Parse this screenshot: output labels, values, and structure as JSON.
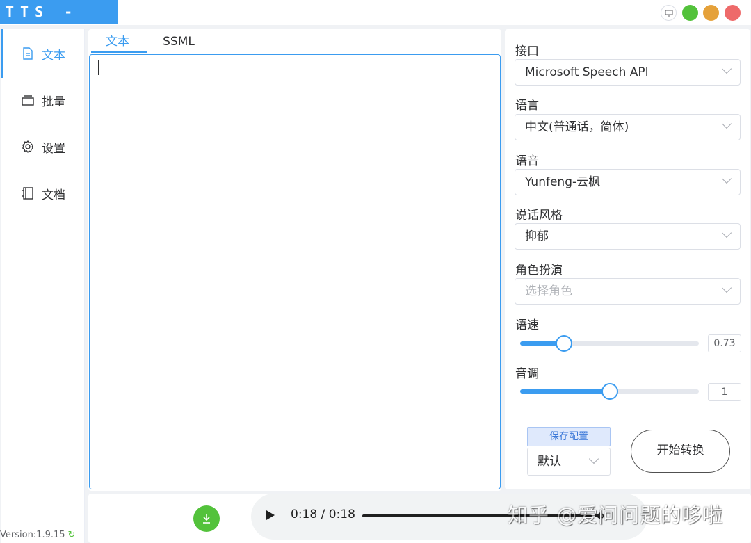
{
  "app": {
    "logo": "TTS - VUE"
  },
  "window_controls": [
    "monitor-icon",
    "green",
    "orange",
    "red"
  ],
  "sidebar": {
    "items": [
      {
        "label": "文本",
        "icon": "document-icon",
        "active": true
      },
      {
        "label": "批量",
        "icon": "stack-icon",
        "active": false
      },
      {
        "label": "设置",
        "icon": "gear-icon",
        "active": false
      },
      {
        "label": "文档",
        "icon": "notebook-icon",
        "active": false
      }
    ],
    "version": "Version:1.9.15",
    "version_icon": "refresh-icon"
  },
  "editor": {
    "tabs": [
      {
        "label": "文本",
        "active": true
      },
      {
        "label": "SSML",
        "active": false
      }
    ],
    "text": ""
  },
  "settings": {
    "api": {
      "label": "接口",
      "value": "Microsoft Speech API"
    },
    "language": {
      "label": "语言",
      "value": "中文(普通话，简体)"
    },
    "voice": {
      "label": "语音",
      "value": "Yunfeng-云枫"
    },
    "style": {
      "label": "说话风格",
      "value": "抑郁"
    },
    "role": {
      "label": "角色扮演",
      "placeholder": "选择角色"
    },
    "rate": {
      "label": "语速",
      "value": "0.73",
      "percent": 24.5
    },
    "pitch": {
      "label": "音调",
      "value": "1",
      "percent": 50
    },
    "save_config": "保存配置",
    "preset": "默认",
    "start": "开始转换"
  },
  "player": {
    "time": "0:18 / 0:18",
    "progress_percent": 100
  },
  "watermark": "知乎 @爱问问题的哆啦",
  "colors": {
    "accent": "#3b9cf0",
    "green": "#53c23b",
    "orange": "#e5a13a",
    "red": "#ee6a6a"
  }
}
